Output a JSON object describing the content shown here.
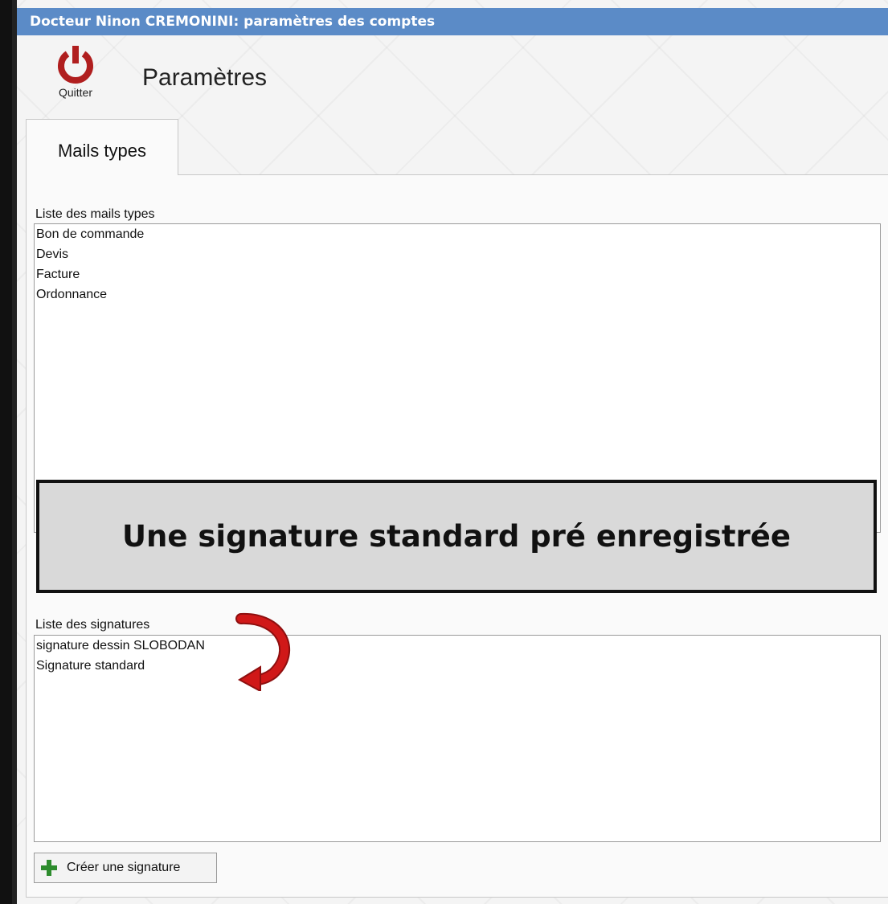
{
  "window": {
    "title": "Docteur Ninon CREMONINI: paramètres des comptes"
  },
  "toolbar": {
    "quit_label": "Quitter",
    "page_title": "Paramètres"
  },
  "tabs": [
    {
      "label": "Mails types",
      "active": true
    }
  ],
  "mail_types": {
    "label": "Liste des mails types",
    "items": [
      "Bon de commande",
      "Devis",
      "Facture",
      "Ordonnance"
    ]
  },
  "signatures": {
    "label": "Liste des signatures",
    "items": [
      "signature dessin SLOBODAN",
      "Signature standard"
    ],
    "create_button": "Créer une signature"
  },
  "callout": {
    "text": "Une signature standard pré enregistrée"
  },
  "colors": {
    "titlebar": "#5b8bc7",
    "quit_icon": "#b01e1e",
    "add_icon": "#2d8c2d",
    "arrow": "#d01818"
  }
}
